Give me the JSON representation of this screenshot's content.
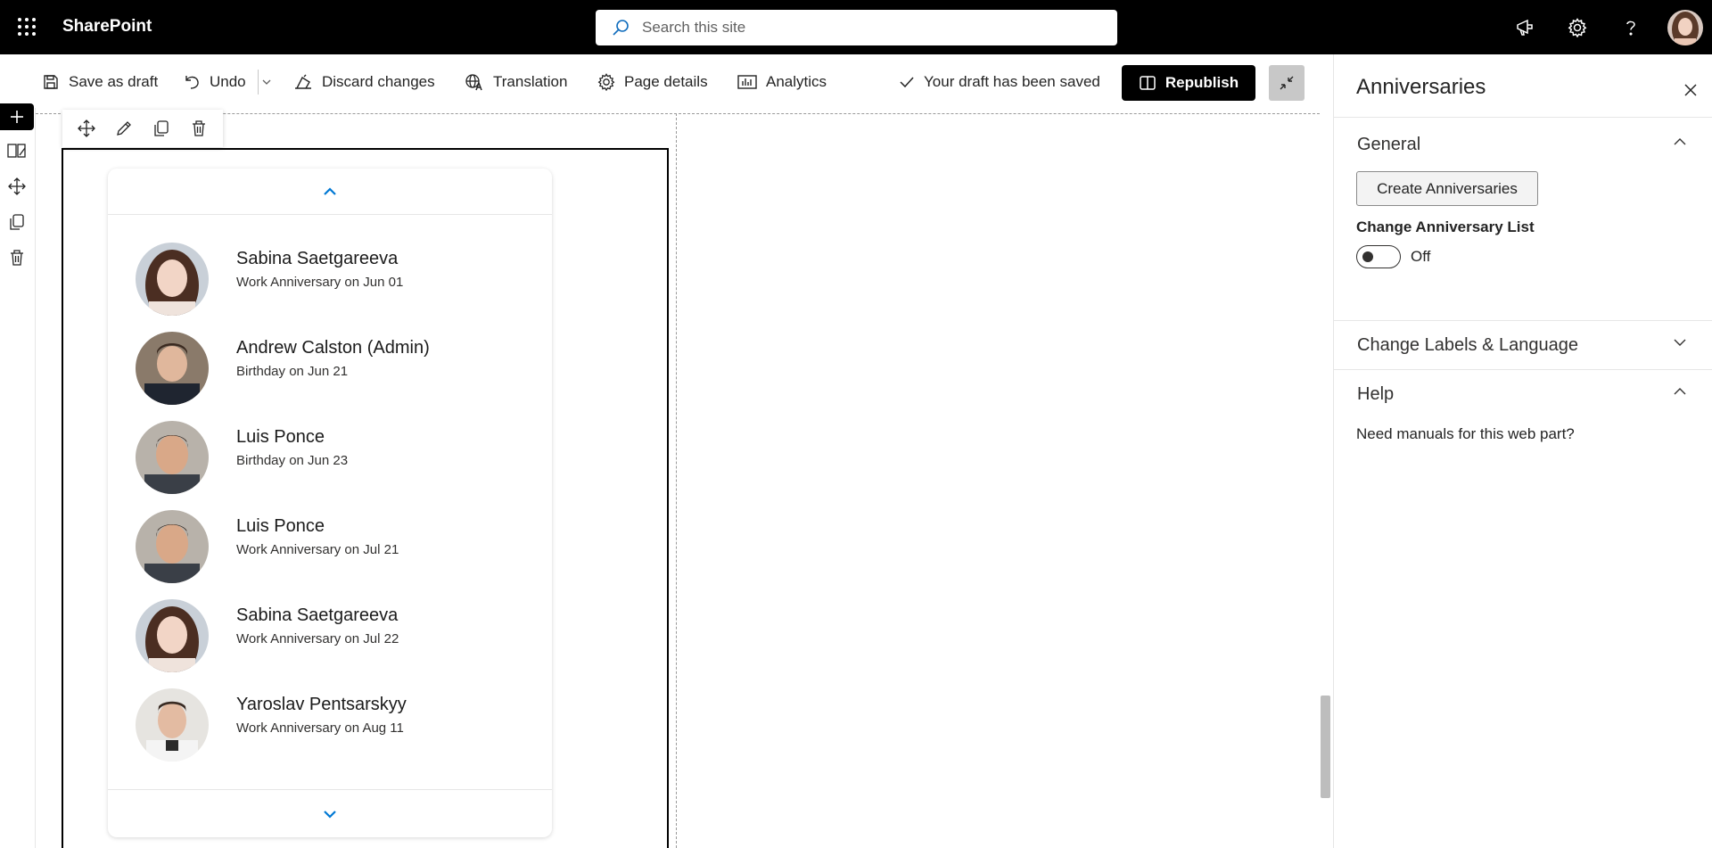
{
  "suite_bar": {
    "app_name": "SharePoint",
    "search_placeholder": "Search this site",
    "icons": [
      "waffle-icon",
      "megaphone-icon",
      "gear-icon",
      "help-icon",
      "avatar"
    ]
  },
  "command_bar": {
    "save_draft": "Save as draft",
    "undo": "Undo",
    "discard": "Discard changes",
    "translation": "Translation",
    "page_details": "Page details",
    "analytics": "Analytics",
    "status": "Your draft has been saved",
    "republish": "Republish"
  },
  "webpart": {
    "people": [
      {
        "name": "Sabina Saetgareeva",
        "event": "Work Anniversary on Jun 01"
      },
      {
        "name": "Andrew Calston (Admin)",
        "event": "Birthday on Jun 21"
      },
      {
        "name": "Luis Ponce",
        "event": "Birthday on Jun 23"
      },
      {
        "name": "Luis Ponce",
        "event": "Work Anniversary on Jul 21"
      },
      {
        "name": "Sabina Saetgareeva",
        "event": "Work Anniversary on Jul 22"
      },
      {
        "name": "Yaroslav Pentsarskyy",
        "event": "Work Anniversary on Aug 11"
      }
    ]
  },
  "property_pane": {
    "title": "Anniversaries",
    "groups": {
      "general": "General",
      "labels": "Change Labels & Language",
      "help": "Help"
    },
    "create_button": "Create Anniversaries",
    "change_list_label": "Change Anniversary List",
    "toggle_state": "Off",
    "help_text": "Need manuals for this web part?"
  },
  "colors": {
    "accent": "#0078d4",
    "black": "#000000"
  }
}
